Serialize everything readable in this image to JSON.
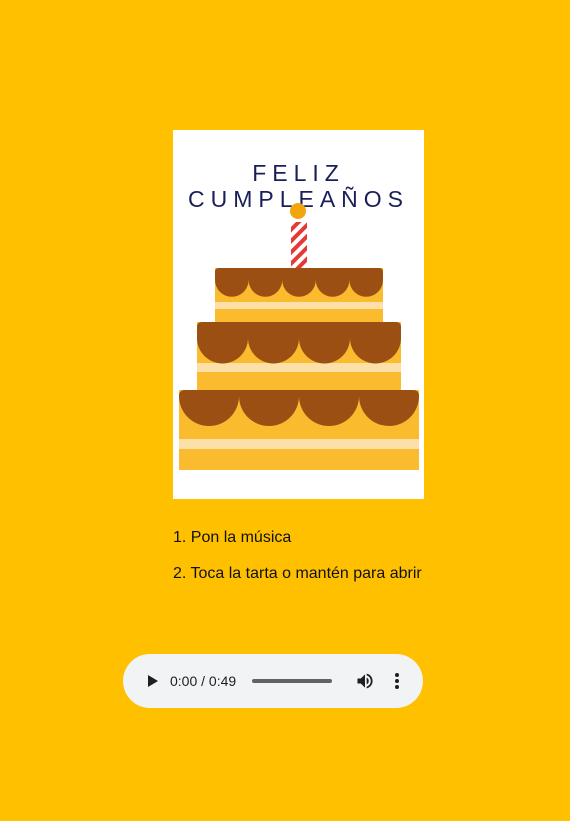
{
  "card": {
    "title_line1": "FELIZ",
    "title_line2": "CUMPLEAÑOS"
  },
  "instructions": [
    "1. Pon la música",
    "2. Toca la tarta o mantén para abrir"
  ],
  "audio": {
    "current_time": "0:00",
    "duration": "0:49",
    "time_display": "0:00 / 0:49",
    "progress": 0
  },
  "colors": {
    "background": "#FFC000",
    "card": "#FFFFFF",
    "title": "#1A1F5A",
    "cake_icing": "#9C4F12",
    "cake_body": "#FBBB2F",
    "cake_stripe": "#FDE0A8",
    "candle": "#E53935",
    "flame": "#F2A50C",
    "player_bg": "#F1F3F4"
  },
  "icons": {
    "play": "play-icon",
    "volume": "volume-icon",
    "more": "more-vert-icon"
  }
}
